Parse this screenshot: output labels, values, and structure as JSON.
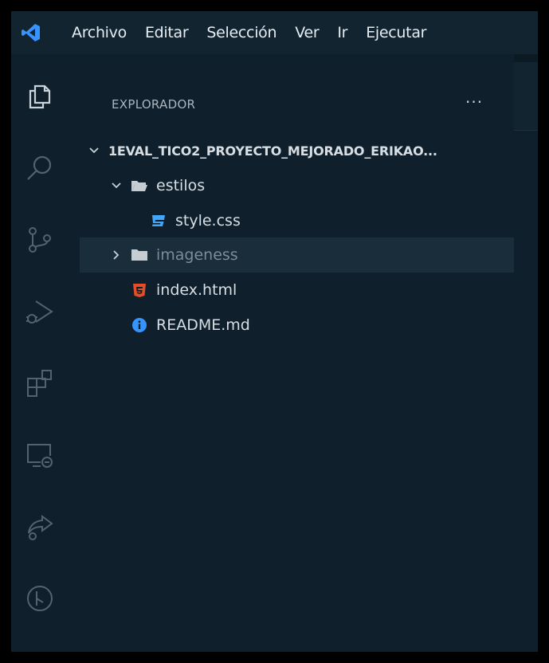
{
  "colors": {
    "background": "#0f1f2b",
    "accent": "#3794ff",
    "html_icon": "#e44d26",
    "css_icon": "#42a5f5",
    "info_icon": "#3794ff"
  },
  "menubar": {
    "logo_icon": "vscode-logo-icon",
    "items": [
      "Archivo",
      "Editar",
      "Selección",
      "Ver",
      "Ir",
      "Ejecutar"
    ]
  },
  "activitybar": {
    "icons": [
      "files-icon",
      "search-icon",
      "source-control-icon",
      "run-debug-icon",
      "extensions-icon",
      "remote-explorer-icon",
      "live-share-icon",
      "timeline-icon"
    ]
  },
  "explorer": {
    "title": "EXPLORADOR",
    "more_label": "···",
    "root": "1EVAL_TICO2_PROYECTO_MEJORADO_ERIKAO...",
    "items": [
      {
        "label": "estilos",
        "type": "folder",
        "expanded": true,
        "icon": "folder-open-icon"
      },
      {
        "label": "style.css",
        "type": "file",
        "icon": "css-file-icon"
      },
      {
        "label": "imageness",
        "type": "folder",
        "expanded": false,
        "icon": "folder-icon"
      },
      {
        "label": "index.html",
        "type": "file",
        "icon": "html-file-icon"
      },
      {
        "label": "README.md",
        "type": "file",
        "icon": "info-icon"
      }
    ]
  }
}
